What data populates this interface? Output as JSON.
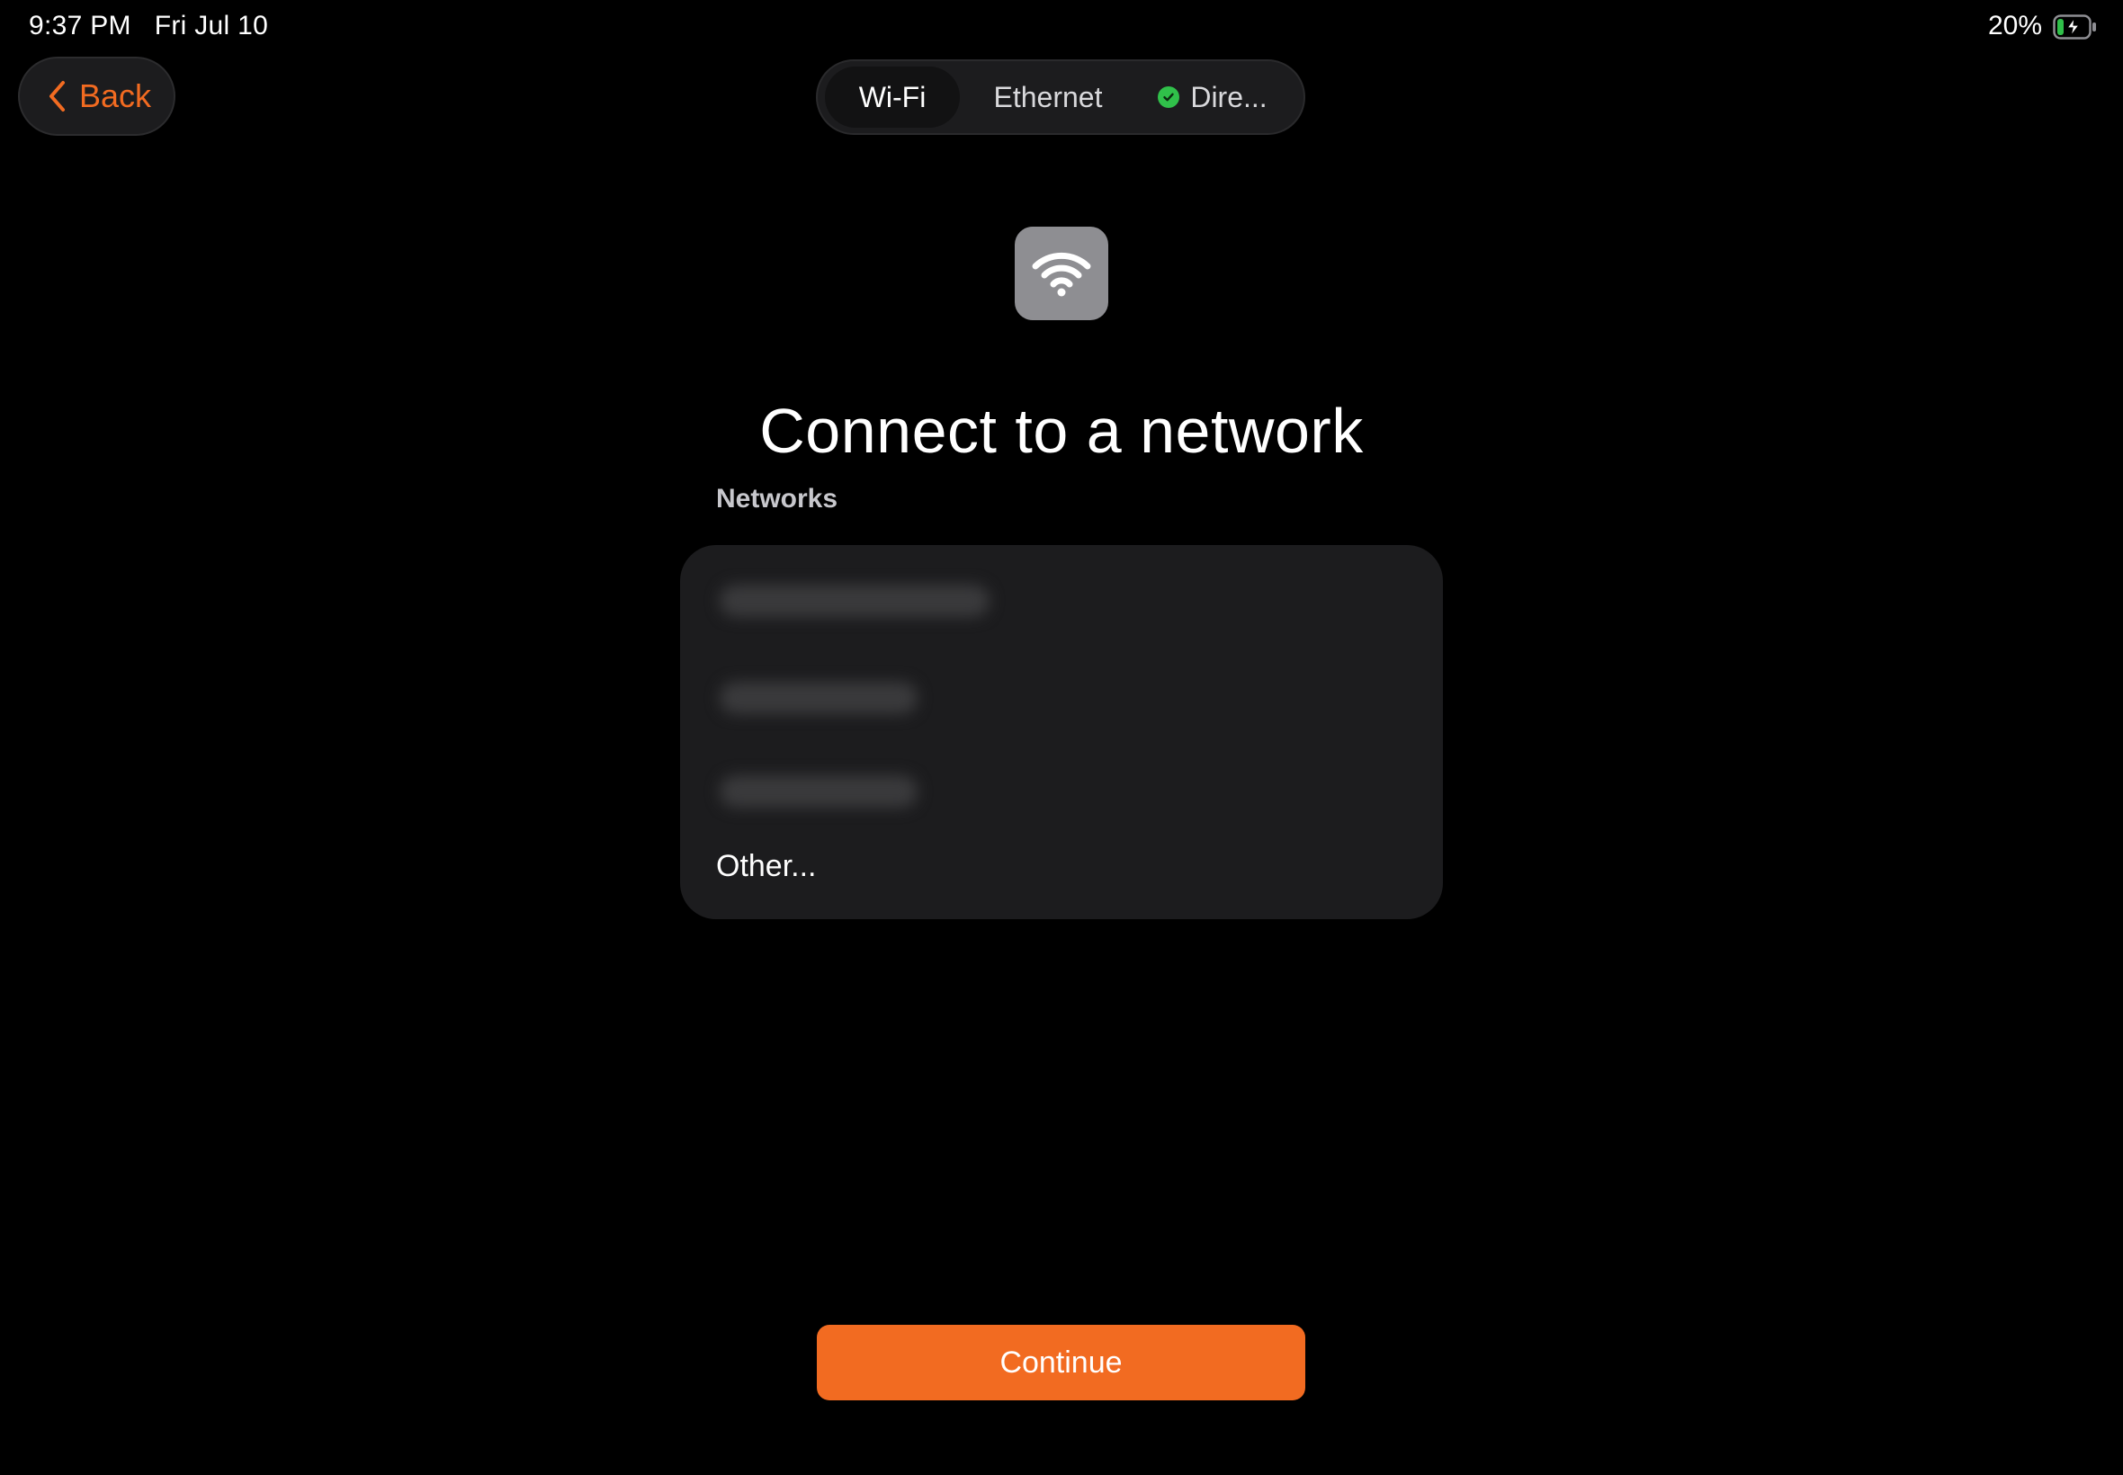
{
  "status_bar": {
    "time": "9:37 PM",
    "date": "Fri Jul 10",
    "battery": "20%",
    "battery_icon": "battery-charging-icon"
  },
  "nav": {
    "back_label": "Back",
    "back_icon": "chevron-left-icon"
  },
  "tabs": [
    {
      "label": "Wi-Fi",
      "active": true
    },
    {
      "label": "Ethernet",
      "active": false
    },
    {
      "label": "Dire...",
      "active": false,
      "status_icon": "check-circle-icon"
    }
  ],
  "header": {
    "icon": "wifi-icon",
    "title": "Connect to a network"
  },
  "networks": {
    "section_label": "Networks",
    "other_label": "Other..."
  },
  "footer": {
    "continue_label": "Continue"
  },
  "colors": {
    "accent": "#f26b21",
    "background": "#000000",
    "card": "#1c1c1e",
    "success": "#30c04a",
    "icon_tile": "#8e8e92"
  }
}
